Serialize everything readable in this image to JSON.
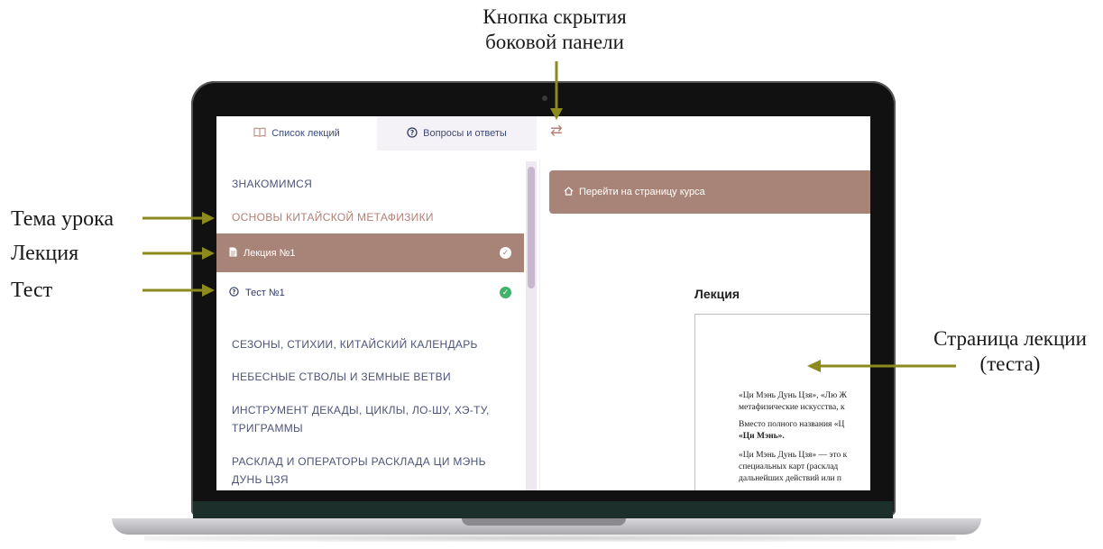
{
  "annotations": {
    "sidebar_toggle_line1": "Кнопка скрытия",
    "sidebar_toggle_line2": "боковой панели",
    "lesson_topic": "Тема урока",
    "lecture": "Лекция",
    "test": "Тест",
    "page_line1": "Страница лекции",
    "page_line2": "(теста)"
  },
  "tabs": {
    "lectures_label": "Список лекций",
    "qa_label": "Вопросы и ответы",
    "lectures_icon": "book-icon",
    "qa_icon": "question-circle-icon"
  },
  "toggle": {
    "icon": "swap-arrows-icon",
    "glyph": "⇄"
  },
  "sidebar": {
    "topics": [
      "ЗНАКОМИМСЯ",
      "ОСНОВЫ КИТАЙСКОЙ МЕТАФИЗИКИ",
      "СЕЗОНЫ, СТИХИИ, КИТАЙСКИЙ КАЛЕНДАРЬ",
      "НЕБЕСНЫЕ СТВОЛЫ И ЗЕМНЫЕ ВЕТВИ",
      "ИНСТРУМЕНТ ДЕКАДЫ, ЦИКЛЫ, ЛО-ШУ, ХЭ-ТУ,",
      "ТРИГРАММЫ",
      "РАСКЛАД И ОПЕРАТОРЫ РАСКЛАДА ЦИ МЭНЬ",
      "ДУНЬ ЦЗЯ"
    ],
    "lesson_label": "Лекция №1",
    "test_label": "Тест №1"
  },
  "main": {
    "course_button": "Перейти на страницу курса",
    "heading": "Лекция",
    "doc_lines": [
      "«Ци Мэнь Дунь Цзя», «Лю Ж",
      "метафизические искусства, к",
      "Вместо полного названия «Ц",
      "«Ци Мэнь».",
      "«Ци Мэнь Дунь Цзя» — это к",
      "специальных карт (расклад",
      "дальнейших действий или п"
    ]
  },
  "colors": {
    "accent": "#a88478",
    "topic_active": "#b27f74",
    "nav_text": "#3b4a78",
    "check_green": "#43b26b",
    "callout_arrow": "#8c8a1c"
  }
}
